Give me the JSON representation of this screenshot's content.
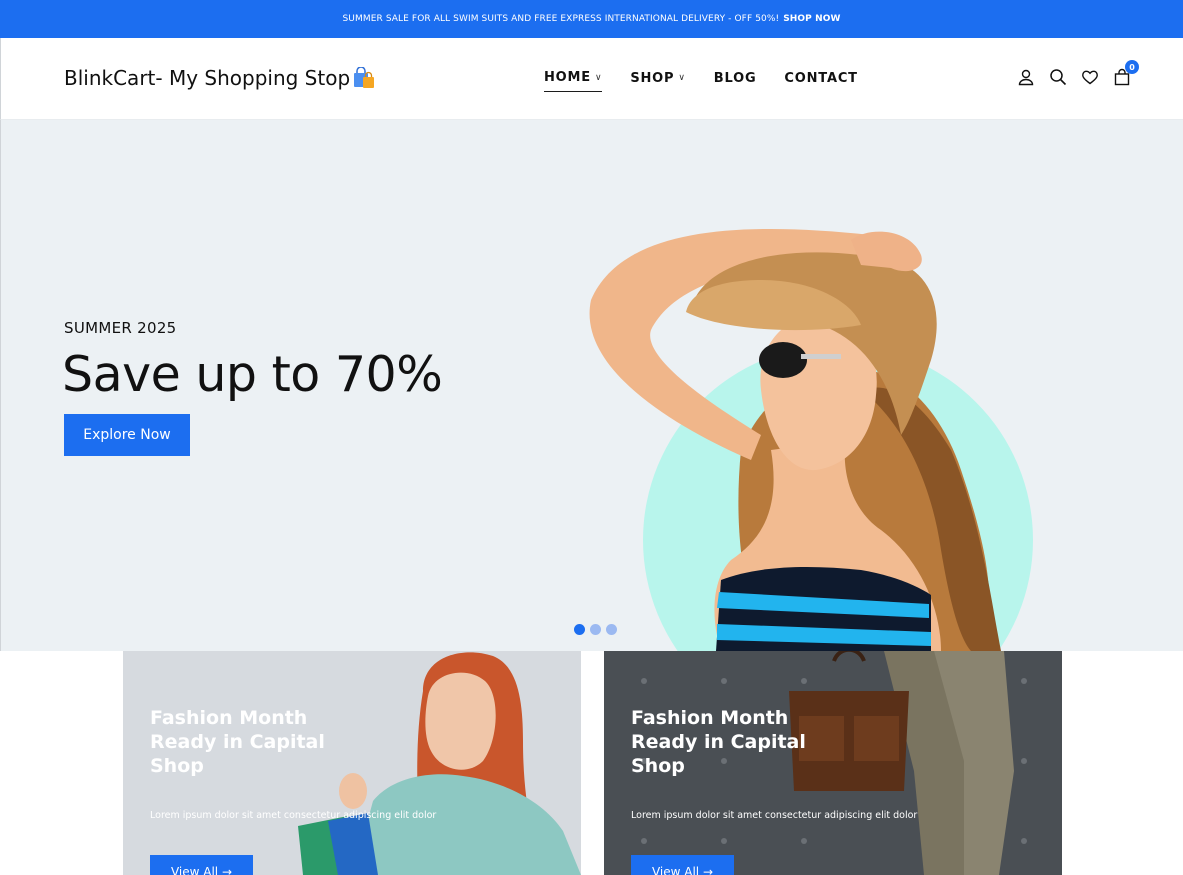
{
  "announcement": {
    "text": "SUMMER SALE FOR ALL SWIM SUITS AND FREE EXPRESS INTERNATIONAL DELIVERY - OFF 50%!",
    "cta": "SHOP NOW"
  },
  "header": {
    "logo_text": "BlinkCart- My Shopping Stop",
    "nav": [
      {
        "label": "HOME",
        "has_dropdown": true,
        "active": true
      },
      {
        "label": "SHOP",
        "has_dropdown": true,
        "active": false
      },
      {
        "label": "BLOG",
        "has_dropdown": false,
        "active": false
      },
      {
        "label": "CONTACT",
        "has_dropdown": false,
        "active": false
      }
    ],
    "icons": [
      "user-icon",
      "search-icon",
      "heart-icon",
      "cart-icon"
    ],
    "cart_count": "0"
  },
  "hero": {
    "subtitle": "SUMMER 2025",
    "title": "Save up to 70%",
    "button": "Explore Now",
    "slides": 3,
    "active_slide": 0
  },
  "banners": [
    {
      "title": "Fashion Month Ready in Capital Shop",
      "description": "Lorem ipsum dolor sit amet consectetur adipiscing elit dolor",
      "button": "View All →"
    },
    {
      "title": "Fashion Month Ready in Capital Shop",
      "description": "Lorem ipsum dolor sit amet consectetur adipiscing elit dolor",
      "button": "View All →"
    }
  ],
  "colors": {
    "accent": "#1c6ef0",
    "hero_bg": "#ecf1f4",
    "hero_circle": "#b8f5ec"
  }
}
